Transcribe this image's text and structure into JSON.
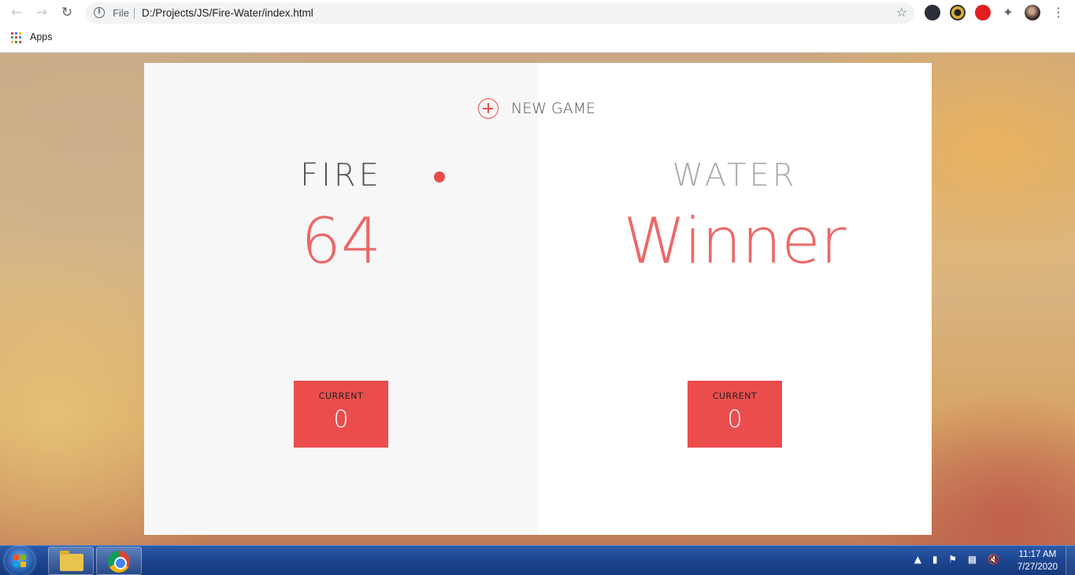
{
  "browser": {
    "url_scheme_label": "File",
    "url": "D:/Projects/JS/Fire-Water/index.html",
    "bookmarks_apps_label": "Apps"
  },
  "game": {
    "new_game_label": "NEW GAME",
    "active_player": "fire",
    "players": [
      {
        "name": "FIRE",
        "score": "64",
        "current_label": "CURRENT",
        "current_score": "0"
      },
      {
        "name": "WATER",
        "score": "Winner",
        "current_label": "CURRENT",
        "current_score": "0"
      }
    ],
    "accent_color": "#eb4d4d"
  },
  "taskbar": {
    "time": "11:17 AM",
    "date": "7/27/2020"
  }
}
